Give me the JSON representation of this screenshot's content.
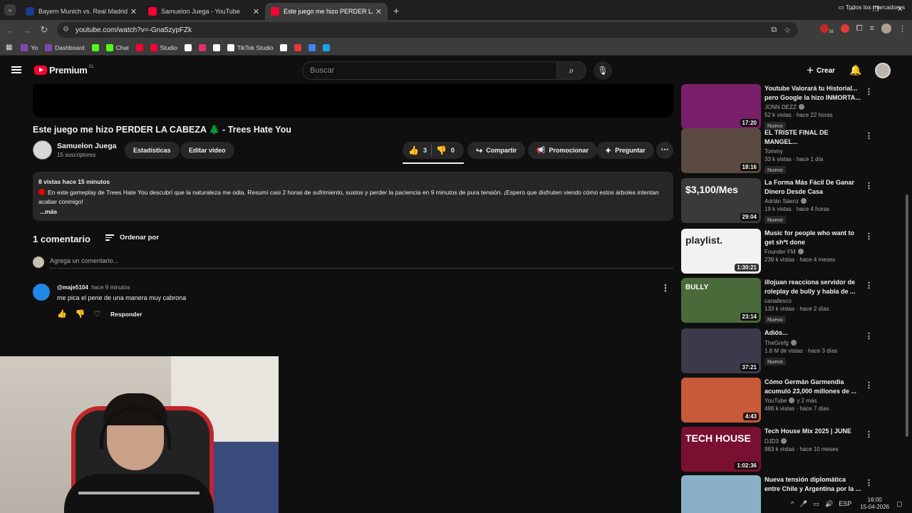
{
  "browser": {
    "tabs": [
      {
        "title": "Bayern Munich vs. Real Madrid",
        "favicon": "bayern",
        "active": false
      },
      {
        "title": "Samuelon Juega - YouTube",
        "favicon": "youtube",
        "active": false
      },
      {
        "title": "Este juego me hizo PERDER LA",
        "favicon": "youtube",
        "active": true
      }
    ],
    "url": "youtube.com/watch?v=-Gna5zypFZk",
    "bookmarks": [
      {
        "label": "Yo",
        "color": "#7b4ab0"
      },
      {
        "label": "Dashboard",
        "color": "#7b4ab0"
      },
      {
        "label": "",
        "color": "#53fc18"
      },
      {
        "label": "Chat",
        "color": "#53fc18"
      },
      {
        "label": "",
        "color": "#ff0033"
      },
      {
        "label": "Studio",
        "color": "#ff0033"
      },
      {
        "label": "",
        "color": "#ffffff"
      },
      {
        "label": "",
        "color": "#e1306c"
      },
      {
        "label": "",
        "color": "#ffffff"
      },
      {
        "label": "TikTok Studio",
        "color": "#ffffff"
      },
      {
        "label": "",
        "color": "#ffffff"
      },
      {
        "label": "",
        "color": "#e53935"
      },
      {
        "label": "",
        "color": "#4285f4"
      },
      {
        "label": "",
        "color": "#1da1f2"
      }
    ],
    "bookmarks_right": "Todos los marcadores",
    "extension_badge": "38"
  },
  "youtube": {
    "logo": "Premium",
    "logo_region": "CL",
    "search_placeholder": "Buscar",
    "create_label": "Crear"
  },
  "video": {
    "title": "Este juego me hizo PERDER LA CABEZA 🌲 - Trees Hate You",
    "channel": "Samuelon Juega",
    "subscribers": "15 suscriptores",
    "buttons": {
      "stats": "Estadísticas",
      "edit": "Editar video",
      "likes": "3",
      "dislikes": "0",
      "share": "Compartir",
      "promote": "Promocionar",
      "ask": "Preguntar"
    },
    "description": {
      "meta": "8 vistas  hace 15 minutos",
      "text": "En este gameplay de Trees Hate You descubrí que la naturaleza me odia. Resumí casi 2 horas de sufrimiento, sustos y perder la paciencia en 9 minutos de pura tensión. ¡Espero que disfruten viendo cómo estos árboles intentan acabar conmigo!",
      "more": "...más"
    }
  },
  "comments": {
    "count_label": "1 comentario",
    "sort_label": "Ordenar por",
    "add_placeholder": "Agrega un comentario...",
    "items": [
      {
        "user": "@maje5104",
        "time": "hace 9 minutos",
        "text": "me pica el pene de una manera muy cabrona",
        "reply": "Responder"
      }
    ]
  },
  "recommendations": [
    {
      "title": "Youtube Valorará tu Historial... pero Google la hizo INMORTA...",
      "channel": "JONN DEZZ",
      "verified": true,
      "stats": "52 k vistas · hace 22 horas",
      "badge": "Nuevo",
      "duration": "17:20",
      "thumb_color": "#7a1f6a"
    },
    {
      "title": "EL TRISTE FINAL DE MANGEL...",
      "channel": "Tommy",
      "verified": false,
      "stats": "33 k vistas · hace 1 día",
      "badge": "Nuevo",
      "duration": "18:16",
      "thumb_color": "#5a4a40"
    },
    {
      "title": "La Forma Más Fácil De Ganar Dinero Desde Casa",
      "channel": "Adrián Sáenz",
      "verified": true,
      "stats": "19 k vistas · hace 4 horas",
      "badge": "Nuevo",
      "duration": "29:04",
      "thumb_color": "#3a3a3a",
      "thumb_text": "$3,100/Mes"
    },
    {
      "title": "Music for people who want to get sh*t done",
      "channel": "Founder FM",
      "verified": true,
      "stats": "239 k vistas · hace 4 meses",
      "badge": "",
      "duration": "1:30:21",
      "thumb_color": "#f2f2f2",
      "thumb_text": "playlist."
    },
    {
      "title": "illojuan reacciona servidor de roleplay de bully y habla de ...",
      "channel": "canallesco",
      "verified": false,
      "stats": "133 k vistas · hace 2 días",
      "badge": "Nuevo",
      "duration": "23:14",
      "thumb_color": "#4a6a3a",
      "thumb_text": "BULLY"
    },
    {
      "title": "Adiós...",
      "channel": "TheGrefg",
      "verified": true,
      "stats": "1.8 M de vistas · hace 3 días",
      "badge": "Nuevo",
      "duration": "37:21",
      "thumb_color": "#3a3a4a"
    },
    {
      "title": "Cómo Germán Garmendia acumuló 23,000 millones de ...",
      "channel": "YouTube",
      "verified": true,
      "channel_extra": "y 2 más",
      "stats": "496 k vistas · hace 7 días",
      "badge": "",
      "duration": "4:43",
      "thumb_color": "#c85a3a"
    },
    {
      "title": "Tech House Mix 2025 | JUNE",
      "channel": "DJD3",
      "verified": true,
      "stats": "983 k vistas · hace 10 meses",
      "badge": "",
      "duration": "1:02:36",
      "thumb_color": "#7a1030",
      "thumb_text": "TECH HOUSE"
    },
    {
      "title": "Nueva tensión diplomática entre Chile y Argentina por la ...",
      "channel": "",
      "verified": false,
      "stats": "",
      "badge": "",
      "duration": "",
      "thumb_color": "#8ab0c8"
    }
  ],
  "taskbar": {
    "lang": "ESP",
    "time": "16:00",
    "date": "15-04-2026"
  }
}
